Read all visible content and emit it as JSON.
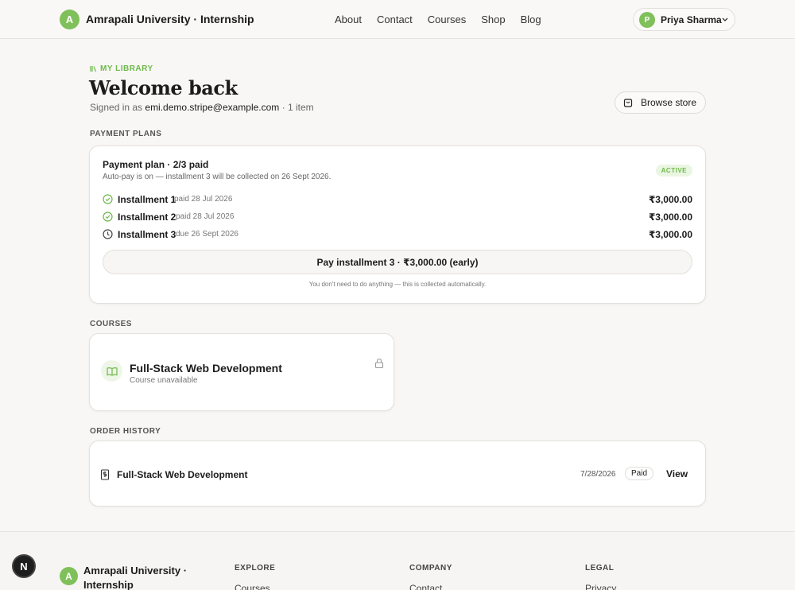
{
  "header": {
    "logo_letter": "A",
    "brand": "Amrapali University · Internship",
    "nav": [
      "About",
      "Contact",
      "Courses",
      "Shop",
      "Blog"
    ],
    "user": {
      "initial": "P",
      "name": "Priya Sharma"
    }
  },
  "intro": {
    "eyebrow": "MY LIBRARY",
    "title": "Welcome back",
    "signed_prefix": "Signed in as ",
    "email": "emi.demo.stripe@example.com",
    "signed_suffix": " · 1 item",
    "browse_label": "Browse store"
  },
  "payment": {
    "section_label": "PAYMENT PLANS",
    "title": "Payment plan · 2/3 paid",
    "subtitle": "Auto-pay is on — installment 3 will be collected on 26 Sept 2026.",
    "status": "ACTIVE",
    "installments": [
      {
        "name": "Installment 1",
        "date": "paid 28 Jul 2026",
        "amount": "₹3,000.00",
        "state": "paid"
      },
      {
        "name": "Installment 2",
        "date": "paid 28 Jul 2026",
        "amount": "₹3,000.00",
        "state": "paid"
      },
      {
        "name": "Installment 3",
        "date": "due 26 Sept 2026",
        "amount": "₹3,000.00",
        "state": "due"
      }
    ],
    "pay_button": "Pay installment 3 · ₹3,000.00 (early)",
    "note": "You don't need to do anything — this is collected automatically."
  },
  "courses": {
    "section_label": "COURSES",
    "items": [
      {
        "title": "Full-Stack Web Development",
        "status": "Course unavailable"
      }
    ]
  },
  "orders": {
    "section_label": "ORDER HISTORY",
    "items": [
      {
        "title": "Full-Stack Web Development",
        "date": "7/28/2026",
        "status": "Paid",
        "action": "View"
      }
    ]
  },
  "footer": {
    "logo_letter": "A",
    "brand": "Amrapali University · Internship",
    "columns": [
      {
        "heading": "EXPLORE",
        "link": "Courses"
      },
      {
        "heading": "COMPANY",
        "link": "Contact"
      },
      {
        "heading": "LEGAL",
        "link": "Privacy"
      }
    ]
  },
  "dev_badge": "N",
  "colors": {
    "accent": "#7fc05a",
    "accent_text": "#6fb84a",
    "background": "#f8f7f5"
  }
}
